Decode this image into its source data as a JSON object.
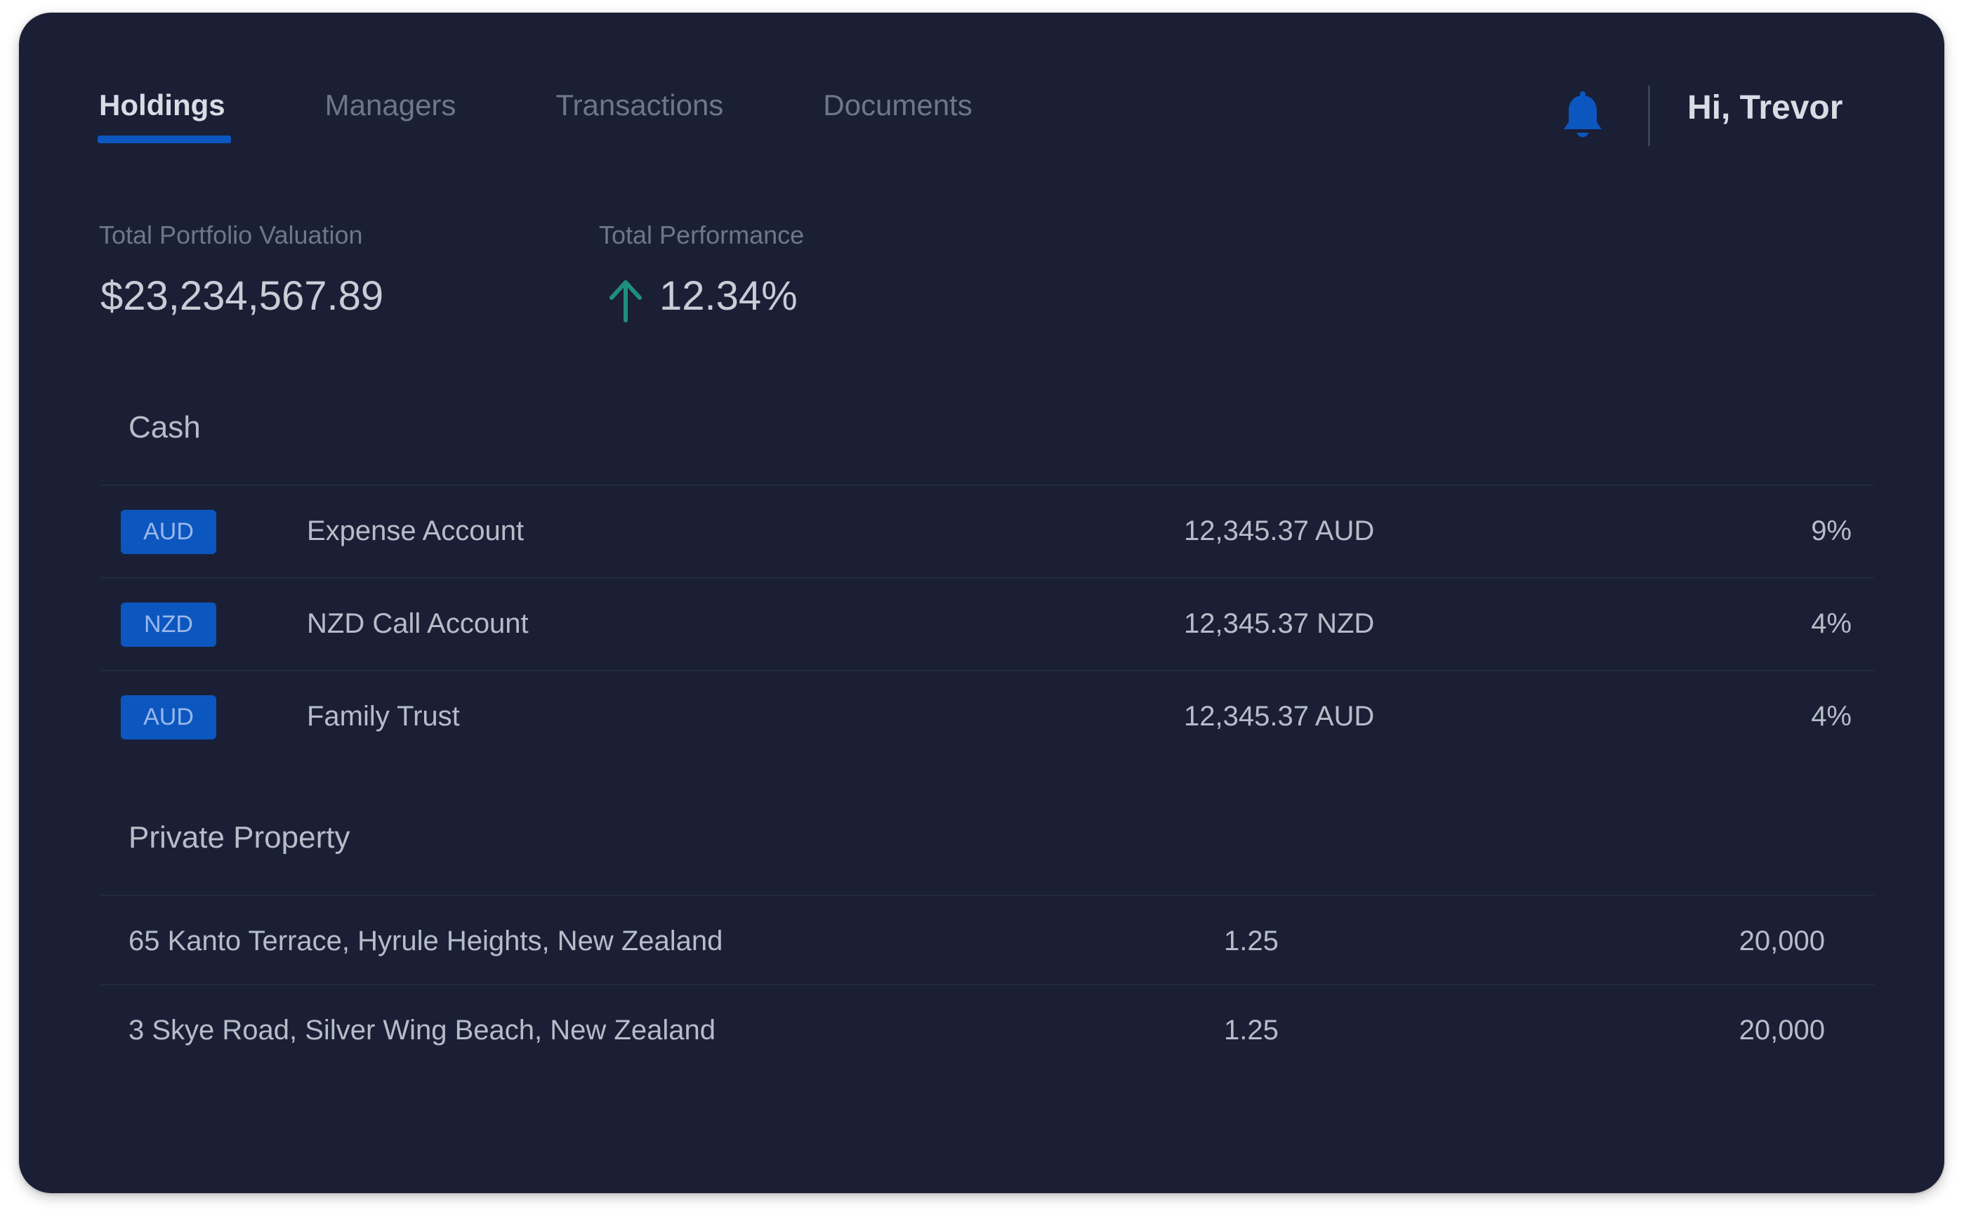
{
  "nav": {
    "tabs": [
      {
        "label": "Holdings",
        "active": true
      },
      {
        "label": "Managers",
        "active": false
      },
      {
        "label": "Transactions",
        "active": false
      },
      {
        "label": "Documents",
        "active": false
      }
    ]
  },
  "header": {
    "notification_icon": "bell-icon",
    "greeting": "Hi, Trevor"
  },
  "summary": {
    "valuation_label": "Total Portfolio Valuation",
    "valuation_value": "$23,234,567.89",
    "performance_label": "Total Performance",
    "performance_value": "12.34%",
    "performance_icon": "arrow-up-icon",
    "performance_color": "#1f8f7d"
  },
  "cash": {
    "title": "Cash",
    "rows": [
      {
        "currency": "AUD",
        "name": "Expense Account",
        "amount": "12,345.37 AUD",
        "percent": "9%"
      },
      {
        "currency": "NZD",
        "name": "NZD Call Account",
        "amount": "12,345.37 NZD",
        "percent": "4%"
      },
      {
        "currency": "AUD",
        "name": "Family Trust",
        "amount": "12,345.37 AUD",
        "percent": "4%"
      }
    ]
  },
  "property": {
    "title": "Private Property",
    "rows": [
      {
        "address": "65 Kanto Terrace, Hyrule Heights, New Zealand",
        "ratio": "1.25",
        "value": "20,000"
      },
      {
        "address": "3 Skye Road, Silver Wing Beach, New Zealand",
        "ratio": "1.25",
        "value": "20,000"
      }
    ]
  },
  "colors": {
    "background": "#1a1f35",
    "accent": "#0c56c0",
    "positive": "#1f8f7d"
  }
}
